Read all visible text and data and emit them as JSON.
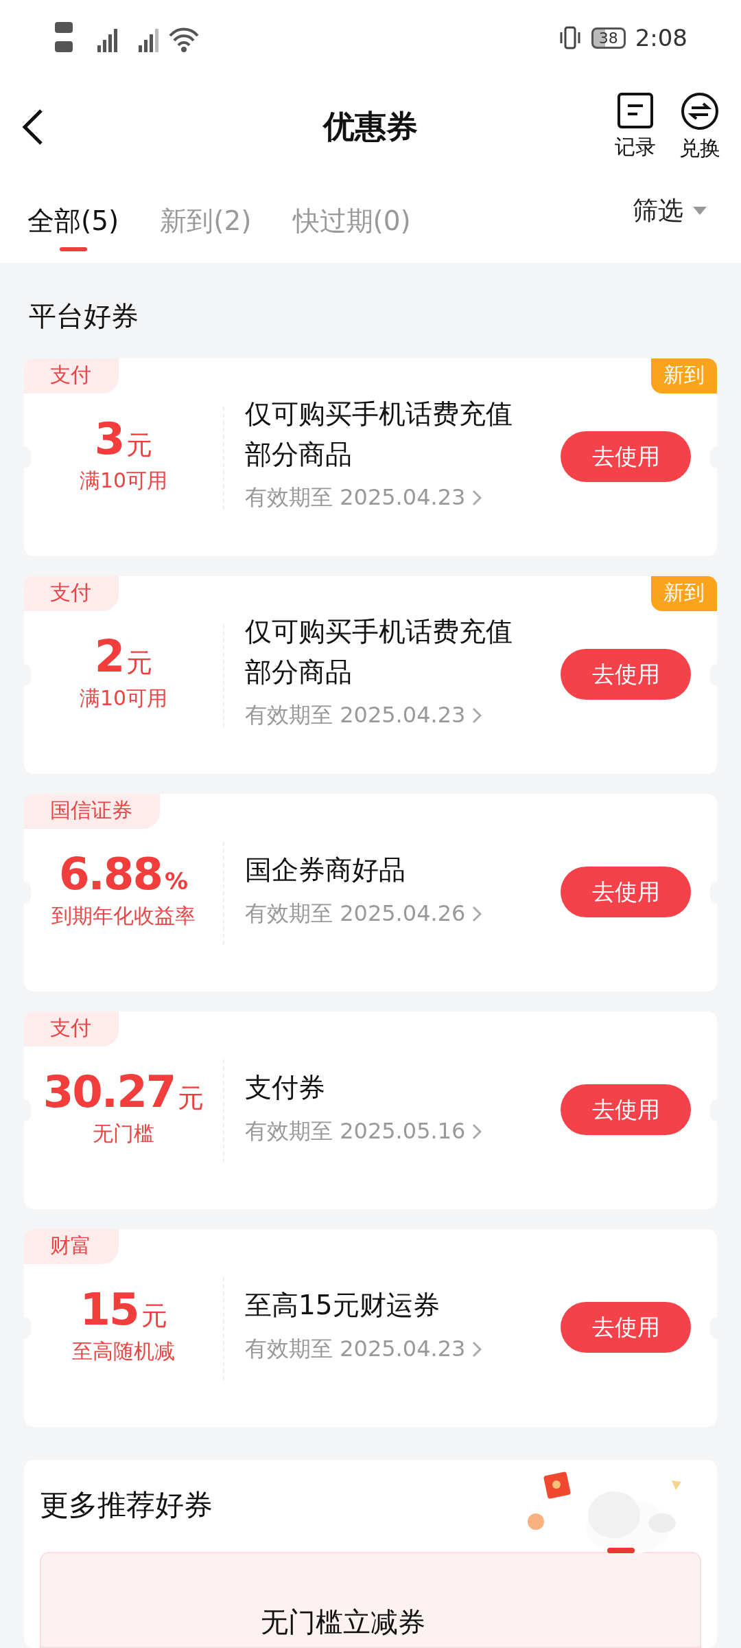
{
  "status_bar": {
    "battery": "38",
    "time": "2:08"
  },
  "header": {
    "title": "优惠券",
    "actions": [
      {
        "kind": "record",
        "label": "记录"
      },
      {
        "kind": "exchange",
        "label": "兑换"
      }
    ]
  },
  "tabs": [
    {
      "label": "全部(5)",
      "selected": true
    },
    {
      "label": "新到(2)",
      "selected": false
    },
    {
      "label": "快过期(0)",
      "selected": false
    }
  ],
  "filter": {
    "label": "筛选"
  },
  "section_title": "平台好券",
  "coupons": [
    {
      "tag": "支付",
      "amount": "3",
      "unit": "元",
      "condition": "满10可用",
      "title": "仅可购买手机话费充值部分商品",
      "expiry": "有效期至 2025.04.23",
      "button": "去使用",
      "badge": "新到"
    },
    {
      "tag": "支付",
      "amount": "2",
      "unit": "元",
      "condition": "满10可用",
      "title": "仅可购买手机话费充值部分商品",
      "expiry": "有效期至 2025.04.23",
      "button": "去使用",
      "badge": "新到"
    },
    {
      "tag": "国信证券",
      "amount": "6.88",
      "unit": "%",
      "condition": "到期年化收益率",
      "title": "国企券商好品",
      "expiry": "有效期至 2025.04.26",
      "button": "去使用"
    },
    {
      "tag": "支付",
      "amount": "30.27",
      "unit": "元",
      "condition": "无门槛",
      "title": "支付券",
      "expiry": "有效期至 2025.05.16",
      "button": "去使用"
    },
    {
      "tag": "财富",
      "amount": "15",
      "unit": "元",
      "condition": "至高随机减",
      "title": "至高15元财运券",
      "expiry": "有效期至 2025.04.23",
      "button": "去使用"
    }
  ],
  "recommend": {
    "title": "更多推荐好券",
    "coupons": [
      {
        "title": "无门槛立减券"
      }
    ]
  }
}
